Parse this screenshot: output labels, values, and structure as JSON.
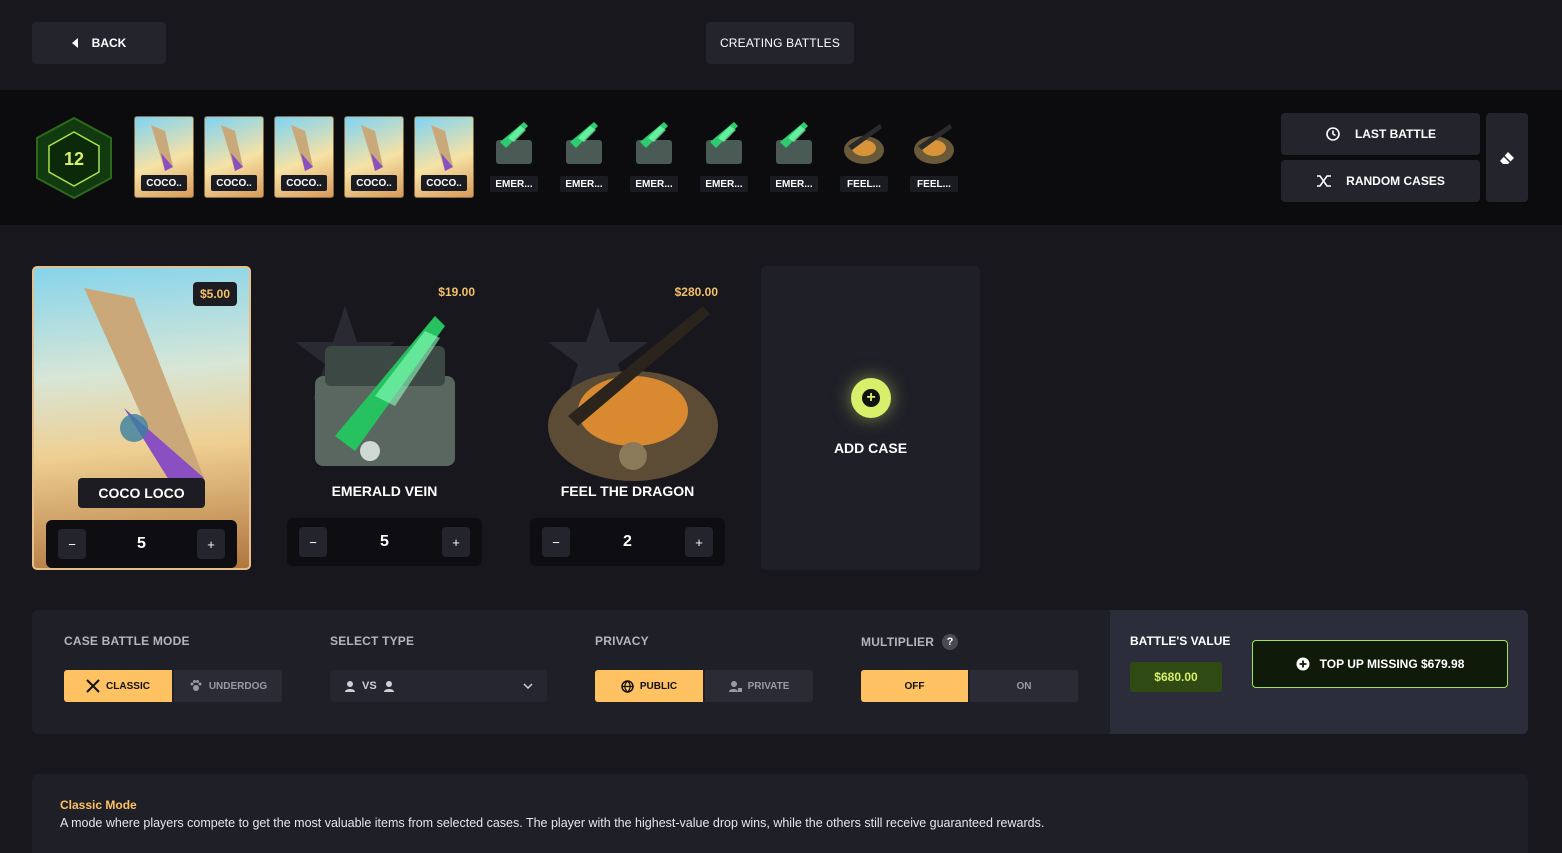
{
  "header": {
    "back_label": "BACK",
    "title": "CREATING BATTLES"
  },
  "strip": {
    "case_count": "12",
    "thumbnails": [
      {
        "label": "COCO.."
      },
      {
        "label": "COCO.."
      },
      {
        "label": "COCO.."
      },
      {
        "label": "COCO.."
      },
      {
        "label": "COCO.."
      },
      {
        "label": "EMER..."
      },
      {
        "label": "EMER..."
      },
      {
        "label": "EMER..."
      },
      {
        "label": "EMER..."
      },
      {
        "label": "EMER..."
      },
      {
        "label": "FEEL..."
      },
      {
        "label": "FEEL..."
      }
    ],
    "last_battle_label": "LAST BATTLE",
    "random_cases_label": "RANDOM CASES"
  },
  "cases": [
    {
      "name": "COCO LOCO",
      "price": "$5.00",
      "quantity": "5"
    },
    {
      "name": "EMERALD VEIN",
      "price": "$19.00",
      "quantity": "5"
    },
    {
      "name": "FEEL THE DRAGON",
      "price": "$280.00",
      "quantity": "2"
    }
  ],
  "add_case_label": "ADD CASE",
  "settings": {
    "mode_label": "CASE BATTLE MODE",
    "mode_options": [
      "CLASSIC",
      "UNDERDOG"
    ],
    "type_label": "SELECT TYPE",
    "type_value": "VS",
    "privacy_label": "PRIVACY",
    "privacy_options": [
      "PUBLIC",
      "PRIVATE"
    ],
    "multiplier_label": "MULTIPLIER",
    "multiplier_options": [
      "OFF",
      "ON"
    ],
    "help_icon_glyph": "?"
  },
  "value": {
    "label": "BATTLE'S VALUE",
    "amount": "$680.00",
    "topup_label": "TOP UP MISSING $679.98"
  },
  "description": {
    "title": "Classic Mode",
    "text": "A mode where players compete to get the most valuable items from selected cases. The player with the highest-value drop wins, while the others still receive guaranteed rewards."
  },
  "colors": {
    "accent": "#fec263",
    "green": "#d8ef6b",
    "background": "#17171d"
  }
}
